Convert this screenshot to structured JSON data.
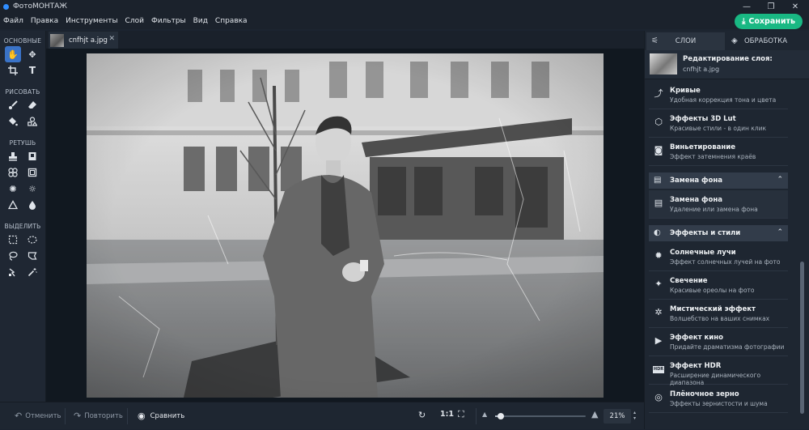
{
  "window": {
    "title": "ФотоМОНТАЖ",
    "minimize": "—",
    "maximize": "❐",
    "close": "✕"
  },
  "menu": [
    "Файл",
    "Правка",
    "Инструменты",
    "Слой",
    "Фильтры",
    "Вид",
    "Справка"
  ],
  "save_button": "Сохранить",
  "toolbox": {
    "sections": [
      {
        "label": "ОСНОВНЫЕ",
        "tools": [
          "hand-icon",
          "move-icon",
          "crop-icon",
          "text-icon"
        ]
      },
      {
        "label": "РИСОВАТЬ",
        "tools": [
          "brush-icon",
          "eraser-icon",
          "fill-icon",
          "shapes-icon"
        ]
      },
      {
        "label": "РЕТУШЬ",
        "tools": [
          "stamp-icon",
          "patch-icon",
          "heal-icon",
          "frame-icon",
          "dodge-icon",
          "burn-icon",
          "sharpen-icon",
          "blur-icon"
        ]
      },
      {
        "label": "ВЫДЕЛИТЬ",
        "tools": [
          "rect-select-icon",
          "ellipse-select-icon",
          "lasso-icon",
          "polygon-lasso-icon",
          "magnetic-lasso-icon",
          "magic-wand-icon"
        ]
      }
    ]
  },
  "document_tab": {
    "name": "cnfhjt a.jpg",
    "close": "✕"
  },
  "bottom": {
    "undo": "Отменить",
    "redo": "Повторить",
    "compare": "Сравнить",
    "actual_size": "1:1",
    "zoom_level": 0.21,
    "zoom_label": "21%"
  },
  "right_panel": {
    "tabs": [
      {
        "label": "СЛОИ"
      },
      {
        "label": "ОБРАБОТКА"
      }
    ],
    "header": {
      "title": "Редактирование слоя:",
      "file": "cnfhjt a.jpg"
    },
    "items_top": [
      {
        "title": "Кривые",
        "subtitle": "Удобная коррекция тона и цвета",
        "icon": "curves-icon"
      },
      {
        "title": "Эффекты 3D Lut",
        "subtitle": "Красивые стили - в один клик",
        "icon": "cube-icon"
      },
      {
        "title": "Виньетирование",
        "subtitle": "Эффект затемнения краёв",
        "icon": "vignette-icon"
      }
    ],
    "group_bg": {
      "title": "Замена фона",
      "icon": "layers-icon",
      "items": [
        {
          "title": "Замена фона",
          "subtitle": "Удаление или замена фона",
          "icon": "layers-icon"
        }
      ]
    },
    "group_fx": {
      "title": "Эффекты и стили",
      "icon": "palette-icon",
      "items": [
        {
          "title": "Солнечные лучи",
          "subtitle": "Эффект солнечных лучей на фото",
          "icon": "sun-rays-icon"
        },
        {
          "title": "Свечение",
          "subtitle": "Красивые ореолы на фото",
          "icon": "sparkle-icon"
        },
        {
          "title": "Мистический эффект",
          "subtitle": "Волшебство на ваших снимках",
          "icon": "mystic-icon"
        },
        {
          "title": "Эффект кино",
          "subtitle": "Придайте драматизма фотографии",
          "icon": "camera-icon"
        },
        {
          "title": "Эффект HDR",
          "subtitle": "Расширение динамического диапазона",
          "icon": "hdr-icon"
        },
        {
          "title": "Плёночное зерно",
          "subtitle": "Эффекты зернистости и шума",
          "icon": "grain-icon"
        }
      ]
    }
  },
  "colors": {
    "accent_green": "#19b883",
    "tool_active": "#3a73c7",
    "panel": "#1e2631"
  }
}
